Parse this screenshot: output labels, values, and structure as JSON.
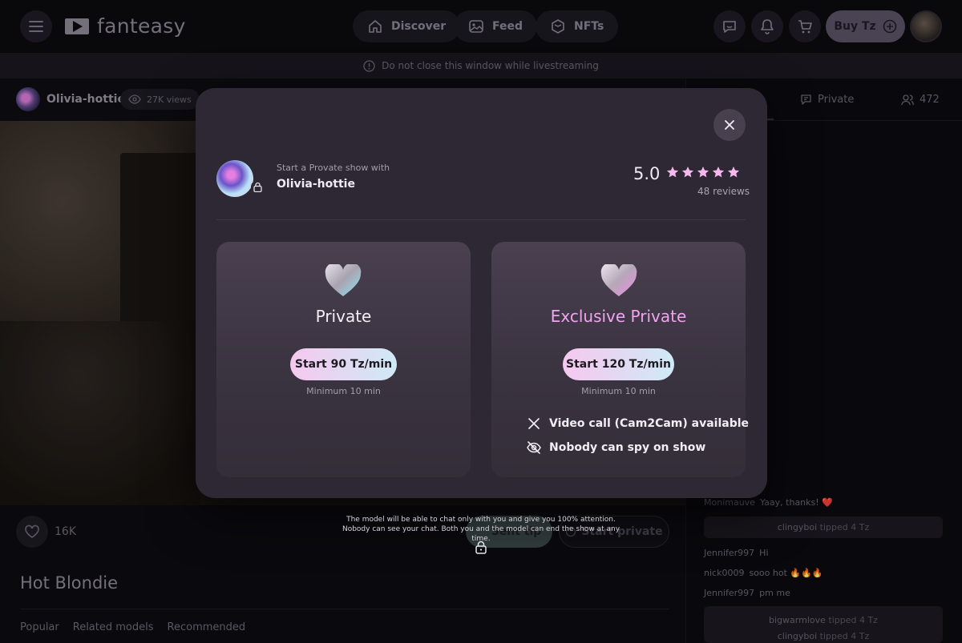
{
  "header": {
    "logo_text": "fanteasy",
    "nav": [
      {
        "label": "Discover",
        "icon": "home-icon"
      },
      {
        "label": "Feed",
        "icon": "feed-icon"
      },
      {
        "label": "NFTs",
        "icon": "nft-icon"
      }
    ],
    "buy_label": "Buy Tz"
  },
  "notice": {
    "text": "Do not close this window while livestreaming"
  },
  "stream": {
    "model_name": "Olivia-hottie",
    "views": "27K views",
    "likes": "16K",
    "send_tip_label": "Sent tip",
    "start_private_label": "Start private",
    "title": "Hot Blondie",
    "tabs": [
      "Popular",
      "Related models",
      "Recommended"
    ]
  },
  "chat": {
    "tabs": {
      "private": "Private",
      "users": "472"
    },
    "messages": [
      {
        "user": "Monimauve",
        "text": "Yaay, thanks! ❤️"
      },
      {
        "user": "Jennifer997",
        "text": "Hi"
      },
      {
        "user": "nick0009",
        "text": "sooo hot 🔥🔥🔥"
      },
      {
        "user": "Jennifer997",
        "text": "pm me"
      }
    ],
    "tips": [
      {
        "user": "clingyboi",
        "text": "tipped 4 Tz"
      },
      {
        "user": "bigwarmlove",
        "text": "tipped 4 Tz"
      },
      {
        "user": "clingyboi",
        "text": "tipped 4 Tz"
      }
    ]
  },
  "modal": {
    "subtitle": "Start a Provate show with",
    "model_name": "Olivia-hottie",
    "rating": "5.0",
    "stars": 5,
    "reviews": "48 reviews",
    "cards": [
      {
        "title": "Private",
        "button": "Start 90 Tz/min",
        "minimum": "Minimum 10 min"
      },
      {
        "title": "Exclusive Private",
        "button": "Start 120 Tz/min",
        "minimum": "Minimum 10 min",
        "features": [
          "Video call (Cam2Cam) available",
          "Nobody can spy on show"
        ]
      }
    ],
    "footnote": "The model will be able to chat only with you and give you 100% attention. Nobody can see your chat. Both you and the model can end the show at any time."
  },
  "colors": {
    "exclusive_title": "#f0a3f0",
    "pill_gradient_start": "#f6c8ef",
    "pill_gradient_end": "#cfeaf6",
    "star": "#f7b8ef"
  }
}
